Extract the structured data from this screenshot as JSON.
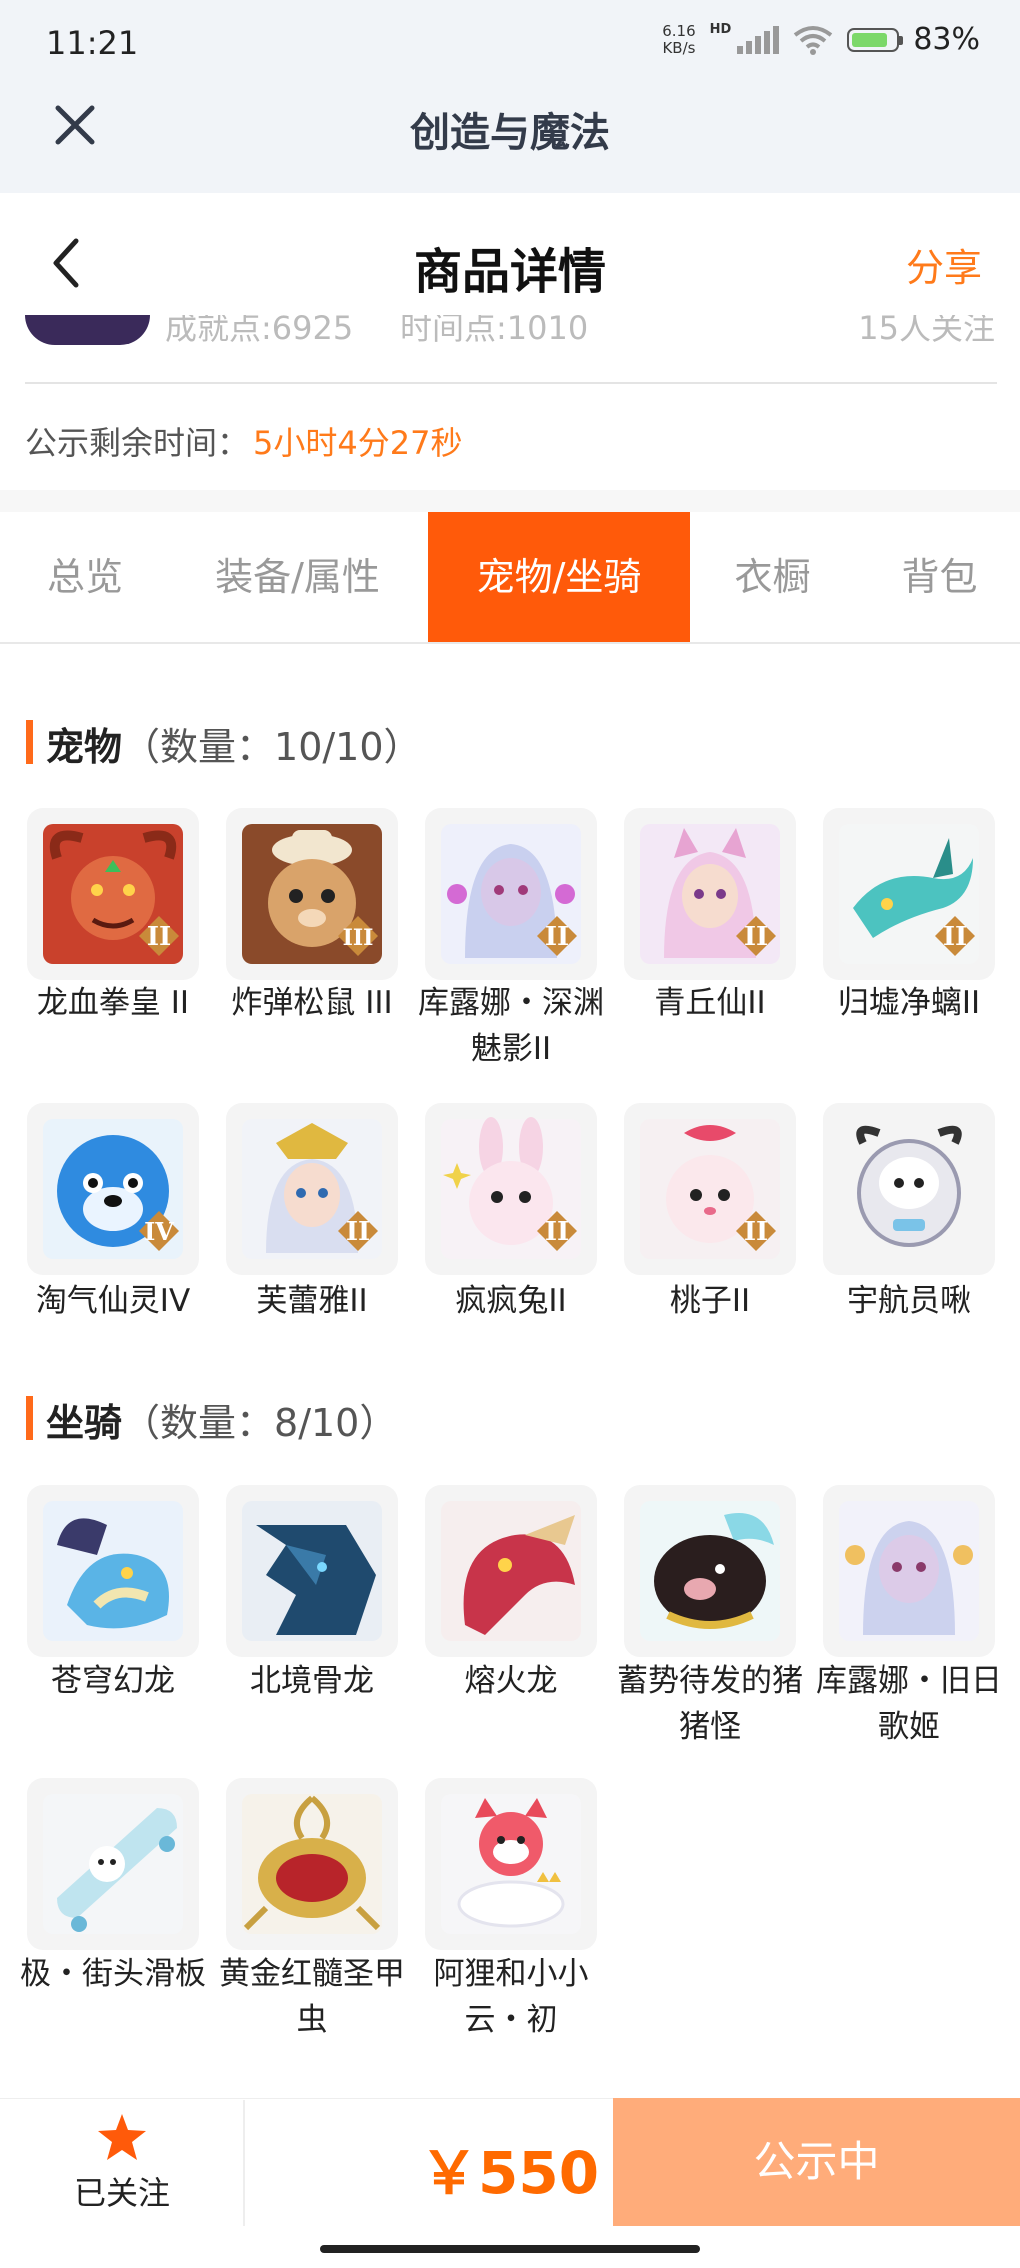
{
  "status_bar": {
    "time": "11:21",
    "net_speed_value": "6.16",
    "net_speed_unit": "KB/s",
    "hd": "HD",
    "battery": "83%",
    "battery_level": 0.83
  },
  "app_header": {
    "title": "创造与魔法",
    "close_icon": "close-icon"
  },
  "page_header": {
    "title": "商品详情",
    "share": "分享",
    "back_icon": "chevron-left-icon"
  },
  "info_row": {
    "achievement": "成就点:6925",
    "time_points": "时间点:1010",
    "followers": "15人关注"
  },
  "timer": {
    "label": "公示剩余时间：",
    "value": "5小时4分27秒"
  },
  "tabs": [
    {
      "label": "总览",
      "active": false
    },
    {
      "label": "装备/属性",
      "active": false
    },
    {
      "label": "宠物/坐骑",
      "active": true
    },
    {
      "label": "衣橱",
      "active": false
    },
    {
      "label": "背包",
      "active": false
    }
  ],
  "pets": {
    "title": "宠物",
    "count": "（数量：10/10）",
    "items": [
      {
        "name": "龙血拳皇 II",
        "tier": "II",
        "icon": "dragon-boxer-pet"
      },
      {
        "name": "炸弹松鼠 III",
        "tier": "III",
        "icon": "squirrel-pet"
      },
      {
        "name": "库露娜・深渊魅影II",
        "tier": "II",
        "icon": "kuluna-pet"
      },
      {
        "name": "青丘仙II",
        "tier": "II",
        "icon": "fox-fairy-pet"
      },
      {
        "name": "归墟净螭II",
        "tier": "II",
        "icon": "sea-dragon-pet"
      },
      {
        "name": "淘气仙灵IV",
        "tier": "IV",
        "icon": "blue-dog-pet"
      },
      {
        "name": "芙蕾雅II",
        "tier": "II",
        "icon": "freya-pet"
      },
      {
        "name": "疯疯兔II",
        "tier": "II",
        "icon": "rabbit-pet"
      },
      {
        "name": "桃子II",
        "tier": "II",
        "icon": "peach-cat-pet"
      },
      {
        "name": "宇航员啾",
        "tier": "",
        "icon": "astronaut-pet"
      }
    ]
  },
  "mounts": {
    "title": "坐骑",
    "count": "（数量：8/10）",
    "items": [
      {
        "name": "苍穹幻龙",
        "icon": "sky-dragon-mount"
      },
      {
        "name": "北境骨龙",
        "icon": "bone-dragon-mount"
      },
      {
        "name": "熔火龙",
        "icon": "lava-dragon-mount"
      },
      {
        "name": "蓄势待发的猪猪怪",
        "icon": "pig-mount"
      },
      {
        "name": "库露娜・旧日歌姬",
        "icon": "kuluna-mount"
      },
      {
        "name": "极・街头滑板",
        "icon": "skateboard-mount"
      },
      {
        "name": "黄金红髓圣甲虫",
        "icon": "scarab-mount"
      },
      {
        "name": "阿狸和小小云・初",
        "icon": "ali-cloud-mount"
      }
    ]
  },
  "bottom_bar": {
    "fav_label": "已关注",
    "fav_icon": "star-icon",
    "price": "￥550",
    "status_button": "公示中"
  },
  "colors": {
    "accent": "#ff5a0a",
    "price": "#ff6a00",
    "status_button": "#ffac7a",
    "header_bg": "#f1f4f8"
  }
}
